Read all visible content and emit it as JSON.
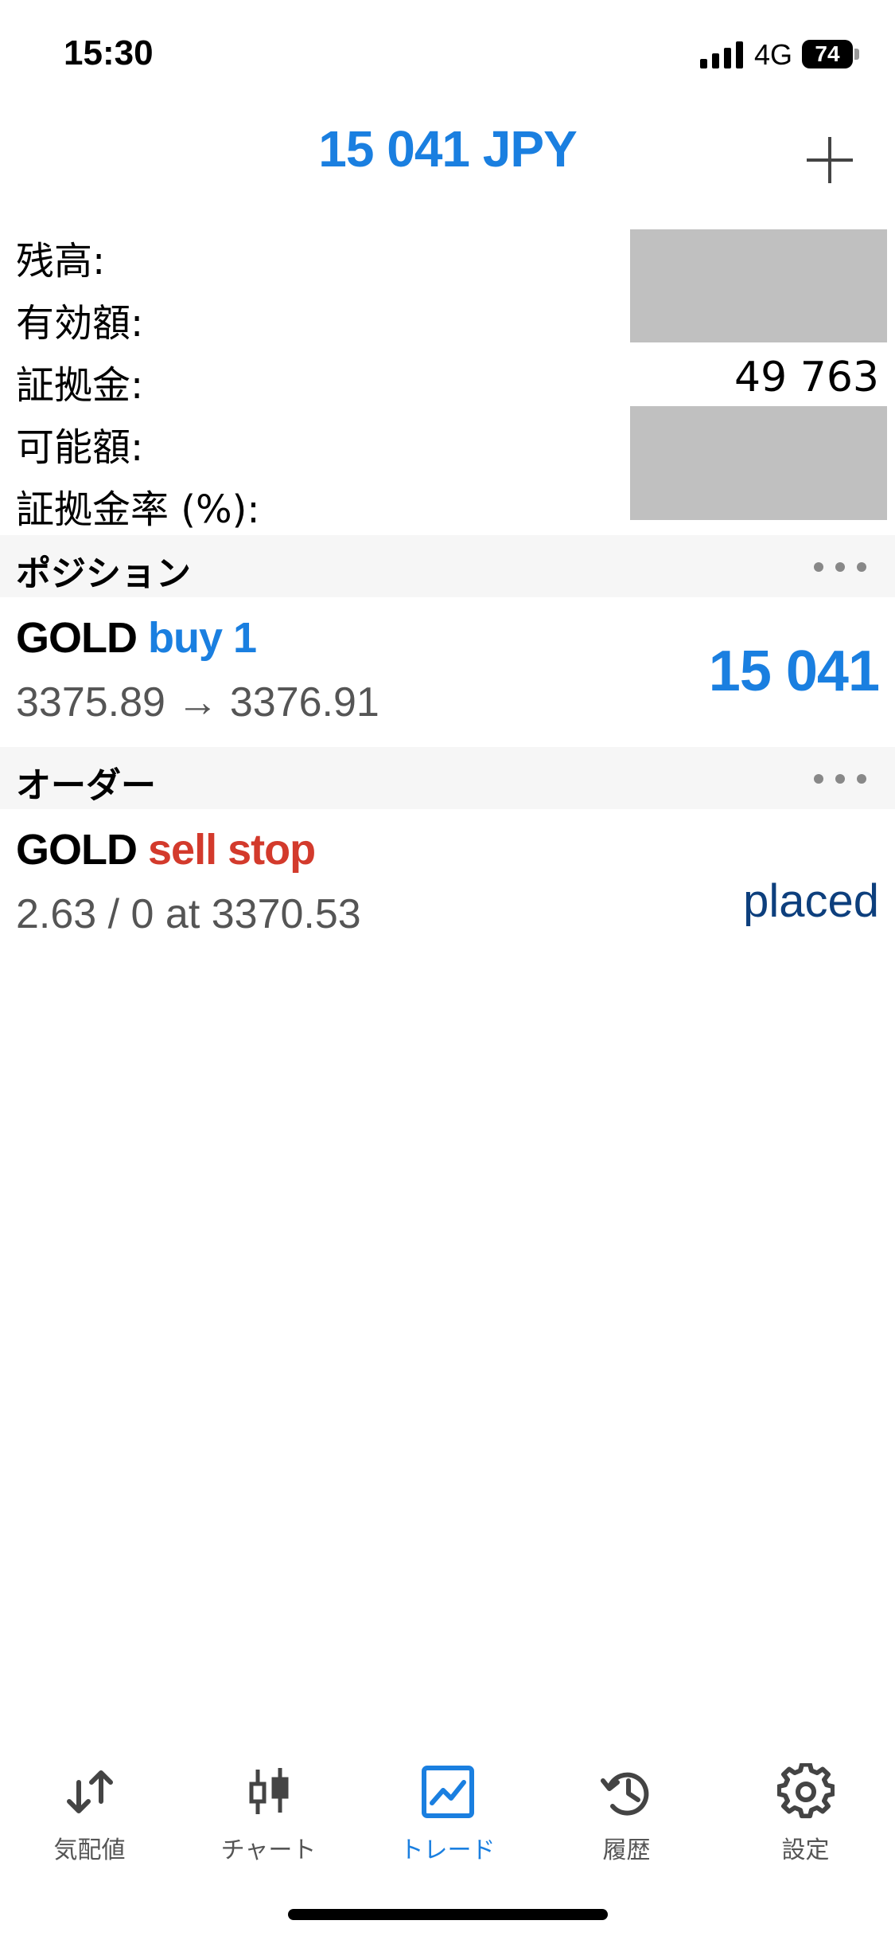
{
  "status_bar": {
    "time": "15:30",
    "network": "4G",
    "battery": "74"
  },
  "header": {
    "balance": "15 041 JPY"
  },
  "summary": [
    {
      "label": "残高:",
      "value": ""
    },
    {
      "label": "有効額:",
      "value": ""
    },
    {
      "label": "証拠金:",
      "value": "49 763"
    },
    {
      "label": "可能額:",
      "value": ""
    },
    {
      "label": "証拠金率 (%):",
      "value": ""
    }
  ],
  "positions": {
    "title": "ポジション",
    "items": [
      {
        "symbol": "GOLD",
        "side": "buy 1",
        "prices": "3375.89 → 3376.91",
        "profit": "15 041"
      }
    ]
  },
  "orders": {
    "title": "オーダー",
    "items": [
      {
        "symbol": "GOLD",
        "side": "sell stop",
        "details": "2.63 / 0 at 3370.53",
        "state": "placed"
      }
    ]
  },
  "tabs": [
    {
      "label": "気配値",
      "icon": "quotes-arrows-icon",
      "active": false
    },
    {
      "label": "チャート",
      "icon": "candlestick-chart-icon",
      "active": false
    },
    {
      "label": "トレード",
      "icon": "trade-line-chart-icon",
      "active": true
    },
    {
      "label": "履歴",
      "icon": "history-clock-icon",
      "active": false
    },
    {
      "label": "設定",
      "icon": "settings-gear-icon",
      "active": false
    }
  ],
  "colors": {
    "accent": "#1a7fe0",
    "sell": "#d33a2c",
    "placed": "#0d3f7d",
    "mask": "#c0c0c0"
  }
}
